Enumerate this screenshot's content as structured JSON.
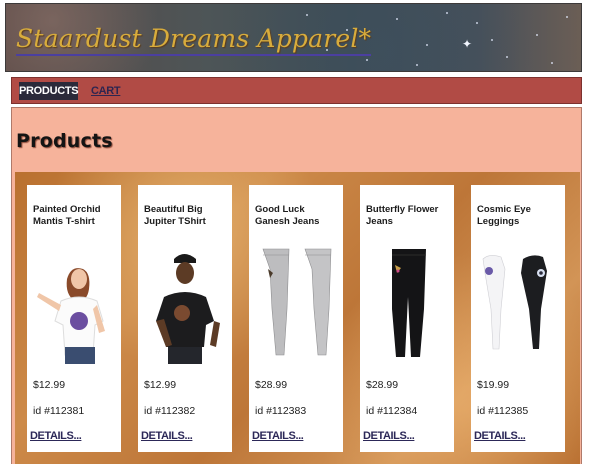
{
  "header": {
    "logo_text": "Staardust Dreams Apparel*"
  },
  "nav": {
    "items": [
      {
        "label": "PRODUCTS",
        "active": true
      },
      {
        "label": "CART",
        "active": false
      }
    ]
  },
  "main": {
    "heading": "Products"
  },
  "products": [
    {
      "name": "Painted Orchid Mantis T-shirt",
      "price": "$12.99",
      "id": "id #112381",
      "details": "DETAILS...",
      "image": "woman-in-white-tshirt"
    },
    {
      "name": "Beautiful Big Jupiter TShirt",
      "price": "$12.99",
      "id": "id #112382",
      "details": "DETAILS...",
      "image": "man-in-black-tshirt"
    },
    {
      "name": "Good Luck Ganesh Jeans",
      "price": "$28.99",
      "id": "id #112383",
      "details": "DETAILS...",
      "image": "grey-jeans"
    },
    {
      "name": "Butterfly Flower Jeans",
      "price": "$28.99",
      "id": "id #112384",
      "details": "DETAILS...",
      "image": "black-jeans"
    },
    {
      "name": "Cosmic Eye Leggings",
      "price": "$19.99",
      "id": "id #112385",
      "details": "DETAILS...",
      "image": "white-and-black-leggings"
    }
  ],
  "colors": {
    "nav": "#b14b45",
    "main_bg": "#f6b39b",
    "logo": "#d8ac3c",
    "link": "#2c2858"
  }
}
